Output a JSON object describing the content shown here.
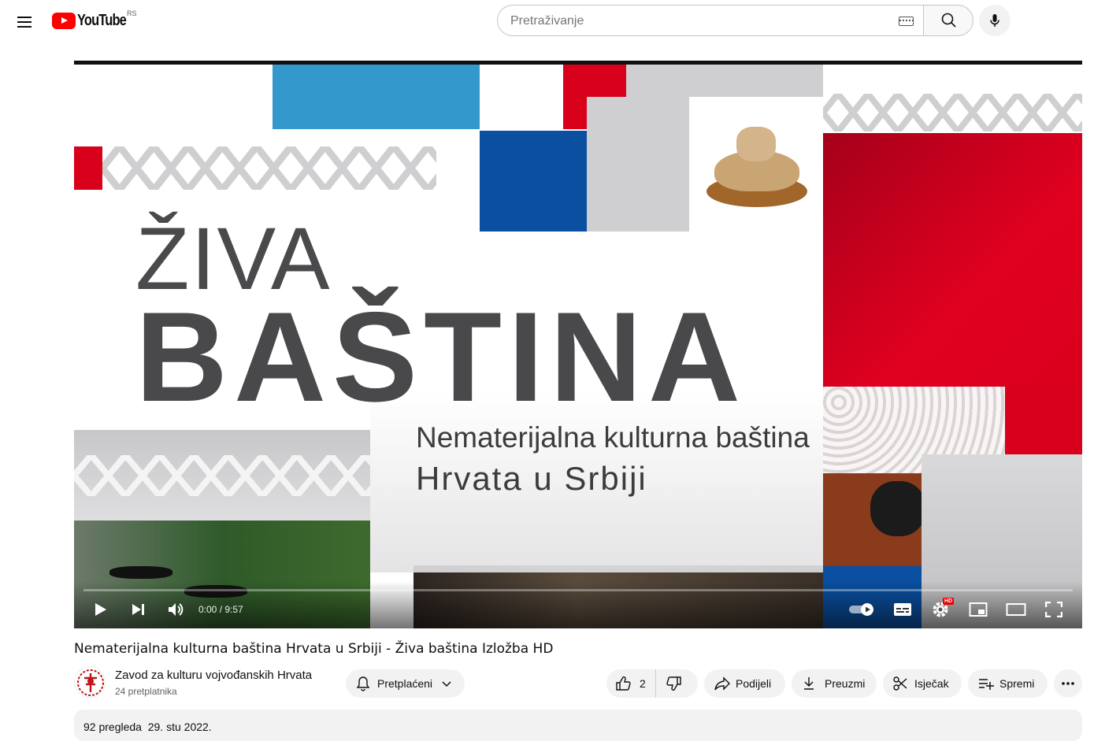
{
  "masthead": {
    "logo_text": "YouTube",
    "country_code": "RS",
    "search_placeholder": "Pretraživanje",
    "icons": [
      "menu-icon",
      "keyboard-icon",
      "search-icon",
      "mic-icon"
    ]
  },
  "player": {
    "thumbnail": {
      "title_line1": "ŽIVA",
      "title_line2": "BAŠTINA",
      "subtitle_line1": "Nematerijalna kulturna baština",
      "subtitle_line2": "Hrvata u Srbiji"
    },
    "time": "0:00 / 9:57",
    "progress": 0,
    "quality_badge": "HD",
    "icons": [
      "play-icon",
      "next-icon",
      "volume-icon",
      "autoplay-toggle-icon",
      "subtitles-icon",
      "settings-icon",
      "miniplayer-icon",
      "theater-icon",
      "fullscreen-icon"
    ]
  },
  "video": {
    "title": "Nematerijalna kulturna baština Hrvata u Srbiji - Živa baština Izložba HD",
    "channel_name": "Zavod za kulturu vojvođanskih Hrvata",
    "subscribers": "24 pretplatnika",
    "subscribe_label": "Pretplaćeni",
    "like_count": "2",
    "share_label": "Podijeli",
    "download_label": "Preuzmi",
    "clip_label": "Isječak",
    "save_label": "Spremi",
    "views": "92 pregleda",
    "date": "29. stu 2022."
  },
  "colors": {
    "brand_red": "#ff0000",
    "croatia_red": "#d9001b",
    "croatia_blue": "#0a4fa0",
    "light_blue": "#3399cc",
    "gray_pattern": "#cfcfd1"
  }
}
